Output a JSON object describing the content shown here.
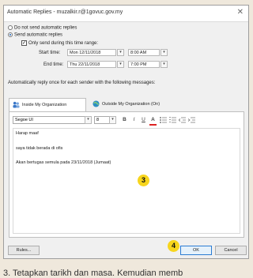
{
  "dialog": {
    "title": "Automatic Replies - muzalkir.r@1govuc.gov.my",
    "close_glyph": "✕"
  },
  "options": {
    "dont_send": "Do not send automatic replies",
    "send": "Send automatic replies",
    "time_range": "Only send during this time range:",
    "start_label": "Start time:",
    "start_date": "Mon 12/11/2018",
    "start_time": "8:00 AM",
    "end_label": "End time:",
    "end_date": "Thu 22/11/2018",
    "end_time": "7:00 PM",
    "selected": "send",
    "time_range_checked": true
  },
  "reply_instruction": "Automatically reply once for each sender with the following messages:",
  "tabs": [
    {
      "label": "Inside My Organization",
      "active": true
    },
    {
      "label": "Outside My Organization (On)",
      "active": false
    }
  ],
  "toolbar": {
    "font": "Segoe UI",
    "size": "8",
    "bold": "B",
    "italic": "I",
    "underline": "U",
    "font_color": "A"
  },
  "message_lines": [
    "Harap maaf",
    "saya tidak berada di ofis",
    "Akan bertugas semula pada 23/11/2018 (Jumaat)"
  ],
  "buttons": {
    "rules": "Rules...",
    "ok": "OK",
    "cancel": "Cancel"
  },
  "callouts": {
    "editor": "3",
    "ok": "4"
  },
  "caption": "3. Tetapkan tarikh dan masa. Kemudian memb",
  "colors": {
    "accent": "#1a5fb4",
    "badge": "#f7d51d"
  }
}
